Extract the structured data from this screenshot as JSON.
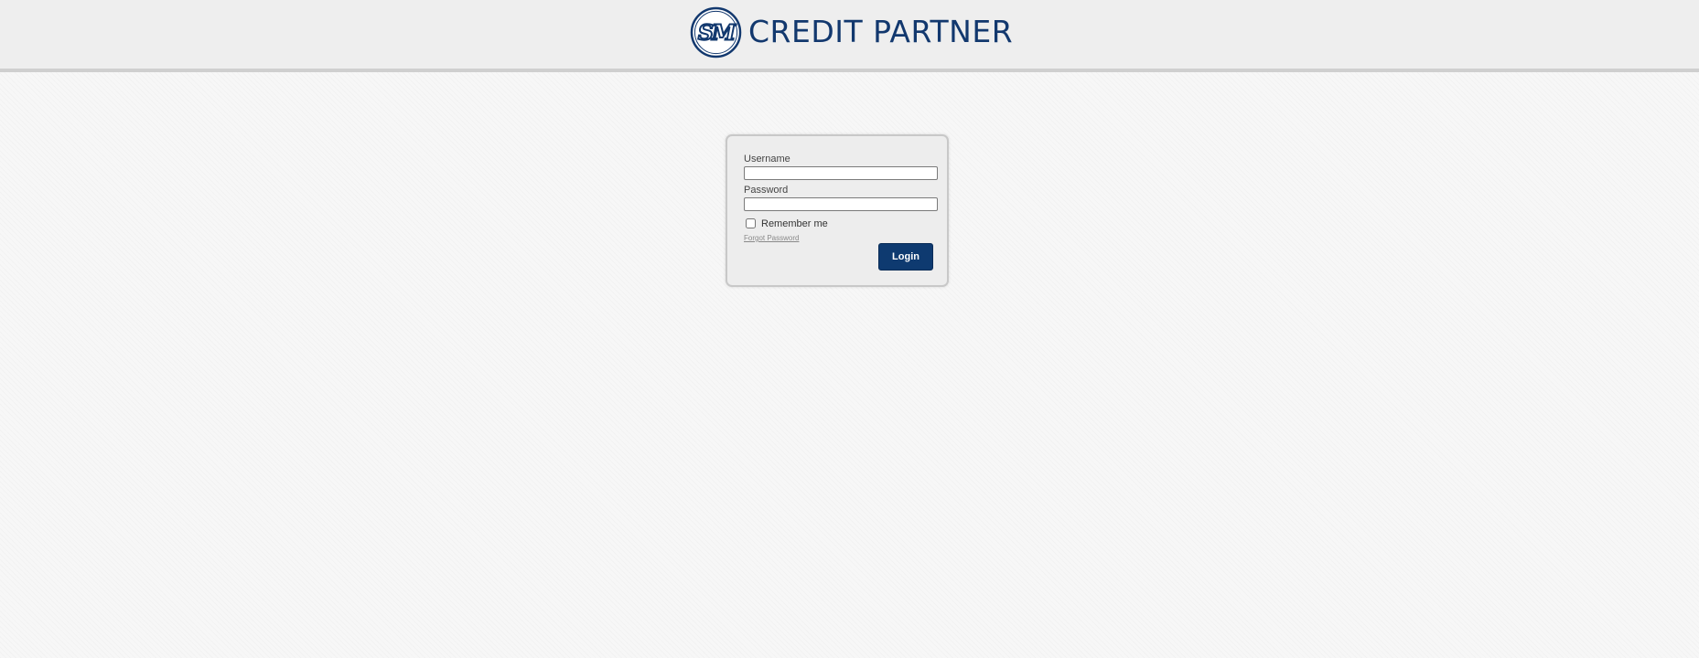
{
  "header": {
    "brand_name": "CREDIT PARTNER",
    "logo": {
      "icon": "sm-logo-icon",
      "text": "SM",
      "color": "#12386e"
    }
  },
  "login_form": {
    "username_label": "Username",
    "username_value": "",
    "password_label": "Password",
    "password_value": "",
    "remember_label": "Remember me",
    "remember_checked": false,
    "forgot_label": "Forgot Password",
    "login_label": "Login"
  },
  "colors": {
    "brand": "#12386e",
    "button": "#0e3a70",
    "header_bg": "#eeeeee",
    "page_bg": "#f7f7f7"
  }
}
